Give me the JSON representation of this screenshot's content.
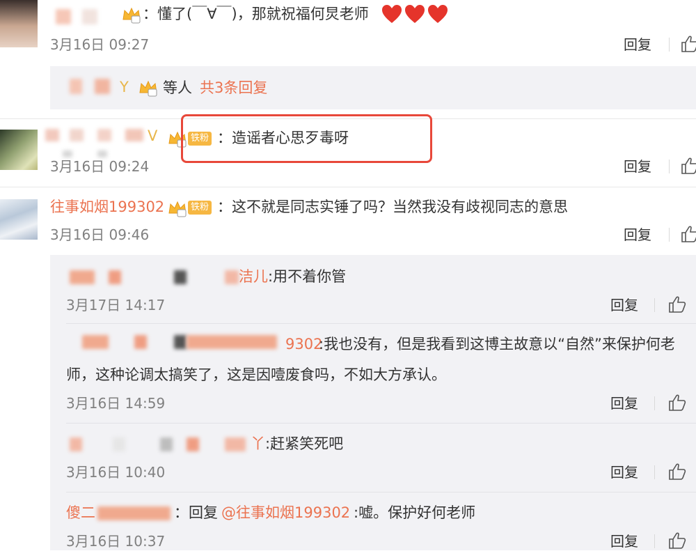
{
  "comment1": {
    "text": "：懂了(￣∀￣)，那就祝福何炅老师",
    "time": "3月16日 09:27",
    "reply_label": "回复",
    "sub_summary": {
      "suffix": "等人",
      "count_text": "共3条回复"
    }
  },
  "comment2": {
    "badge": "铁粉",
    "text": "：造谣者心思歹毒呀",
    "time": "3月16日 09:24",
    "reply_label": "回复"
  },
  "comment3": {
    "username": "往事如烟199302",
    "badge": "铁粉",
    "text": "：这不就是同志实锤了吗？当然我没有歧视同志的意思",
    "time": "3月16日 09:46",
    "reply_label": "回复",
    "replies": [
      {
        "name_tail": "洁儿",
        "text": ":用不着你管",
        "time": "3月17日 14:17",
        "reply_label": "回复"
      },
      {
        "name_tail": "9302",
        "text": ":我也没有，但是我看到这博主故意以“自然”来保护何老",
        "text_line2": "师，这种论调太搞笑了，这是因噎废食吗，不如大方承认。",
        "time": "3月16日 14:59",
        "reply_label": "回复"
      },
      {
        "name_tail": "丫",
        "text": ":赶紧笑死吧",
        "time": "3月16日 10:40",
        "reply_label": "回复"
      },
      {
        "name_head": "傻二",
        "text_mid": "：回复",
        "mention": "@往事如烟199302",
        "text": ":嘘。保护好何老师",
        "time": "3月16日 10:37",
        "reply_label": "回复"
      }
    ]
  },
  "colors": {
    "accent": "#eb7350",
    "highlight_box": "#e8483a",
    "badge_bg": "#f6b742",
    "heart": "#e5342b"
  },
  "icons": [
    "crown-icon",
    "heart-icon",
    "thumbs-up-icon",
    "fan-badge"
  ]
}
